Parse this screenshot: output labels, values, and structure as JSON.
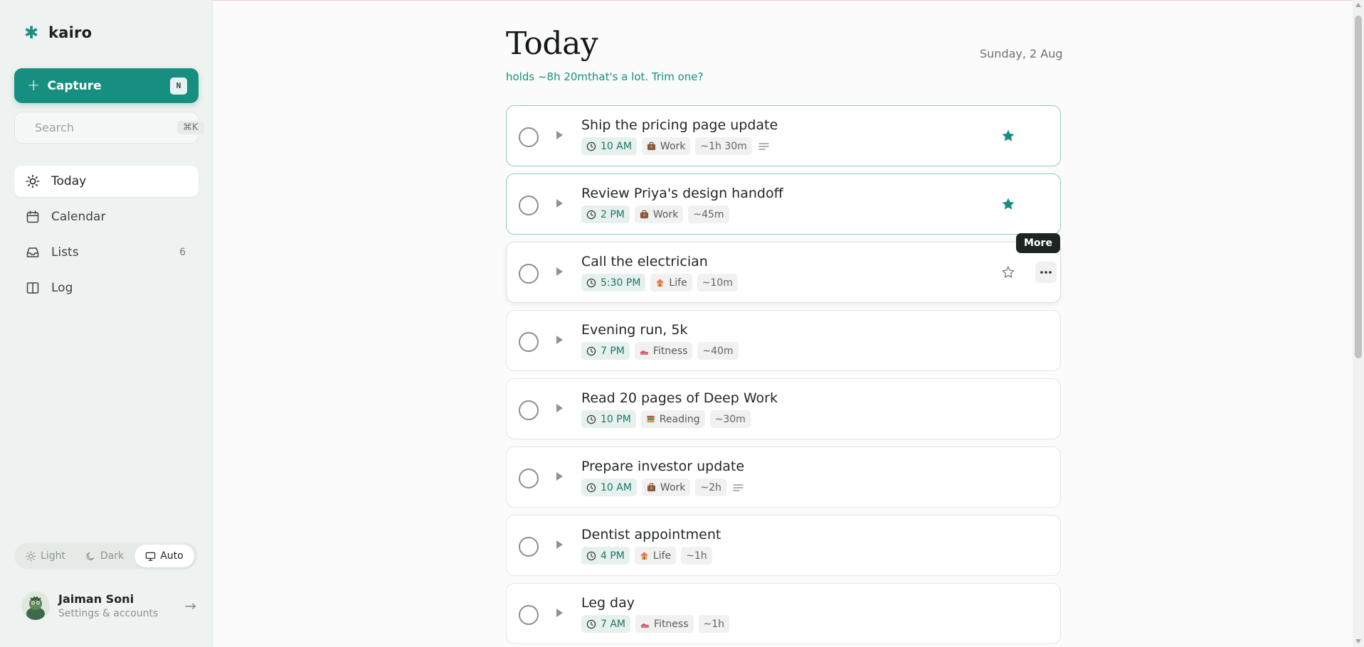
{
  "brand": {
    "mark": "✱",
    "name": "kairo"
  },
  "capture": {
    "label": "Capture",
    "shortcut": "N"
  },
  "search": {
    "placeholder": "Search",
    "shortcut": "⌘K"
  },
  "nav": {
    "items": [
      {
        "label": "Today",
        "icon": "sun-icon",
        "active": true
      },
      {
        "label": "Calendar",
        "icon": "calendar-icon"
      },
      {
        "label": "Lists",
        "icon": "inbox-icon",
        "count": "6"
      },
      {
        "label": "Log",
        "icon": "book-icon"
      }
    ]
  },
  "theme": {
    "options": [
      "Light",
      "Dark",
      "Auto"
    ],
    "selected": "Auto"
  },
  "account": {
    "name": "Jaiman Soni",
    "sub": "Settings & accounts",
    "arrow": "→"
  },
  "page": {
    "title": "Today",
    "subtitle": "holds ~8h 20mthat's a lot. Trim one?",
    "date": "Sunday, 2 Aug"
  },
  "tooltip": "More",
  "colors": {
    "accent": "#178f80",
    "accent_light": "#e6f1ee",
    "work": "#a06a4a",
    "life": "#e8744c",
    "fitness": "#e0586a",
    "reading": "#c97a3a"
  },
  "tasks": [
    {
      "title": "Ship the pricing page update",
      "time": "10 AM",
      "category": "Work",
      "duration": "~1h 30m",
      "notes": true,
      "starred": true
    },
    {
      "title": "Review Priya's design handoff",
      "time": "2 PM",
      "category": "Work",
      "duration": "~45m",
      "notes": false,
      "starred": true
    },
    {
      "title": "Call the electrician",
      "time": "5:30 PM",
      "category": "Life",
      "duration": "~10m",
      "notes": false,
      "starred": false,
      "hover": true
    },
    {
      "title": "Evening run, 5k",
      "time": "7 PM",
      "category": "Fitness",
      "duration": "~40m",
      "notes": false,
      "starred": false
    },
    {
      "title": "Read 20 pages of Deep Work",
      "time": "10 PM",
      "category": "Reading",
      "duration": "~30m",
      "notes": false,
      "starred": false
    },
    {
      "title": "Prepare investor update",
      "time": "10 AM",
      "category": "Work",
      "duration": "~2h",
      "notes": true,
      "starred": false
    },
    {
      "title": "Dentist appointment",
      "time": "4 PM",
      "category": "Life",
      "duration": "~1h",
      "notes": false,
      "starred": false
    },
    {
      "title": "Leg day",
      "time": "7 AM",
      "category": "Fitness",
      "duration": "~1h",
      "notes": false,
      "starred": false
    }
  ]
}
